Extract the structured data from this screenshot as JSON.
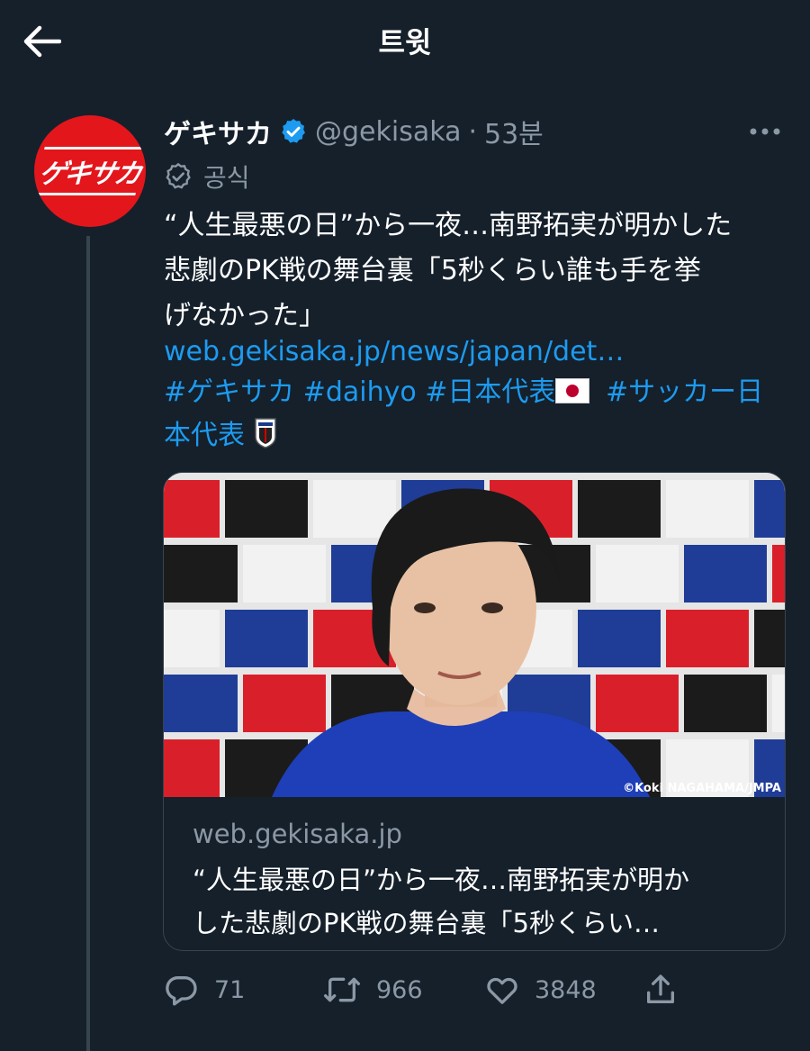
{
  "header": {
    "title": "트윗"
  },
  "tweet": {
    "avatar_text": "ゲキサカ",
    "author_name": "ゲキサカ",
    "handle": "@gekisaka",
    "separator": "·",
    "time": "53분",
    "official_label": "공식",
    "text": "“人生最悪の日”から一夜…南野拓実が明かした\n悲劇のPK戦の舞台裏「5秒くらい誰も手を挙\nげなかった」",
    "link": "web.gekisaka.jp/news/japan/det…",
    "hashtags": {
      "tag1": "#ゲキサカ",
      "tag2": "#daihyo",
      "tag3": "#日本代表",
      "tag4_line1": "#サッカー日",
      "tag4_line2": "本代表"
    }
  },
  "card": {
    "photo_credit": "©Koki NAGAHAMA/JMPA",
    "domain": "web.gekisaka.jp",
    "title": "“人生最悪の日”から一夜…南野拓実が明か\nした悲劇のPK戦の舞台裏「5秒くらい…"
  },
  "actions": {
    "replies": "71",
    "retweets": "966",
    "likes": "3848"
  },
  "colors": {
    "background": "#15202b",
    "link": "#1d9bf0",
    "secondary_text": "#8b98a5",
    "verified": "#1d9bf0",
    "avatar_bg": "#e3161c"
  }
}
